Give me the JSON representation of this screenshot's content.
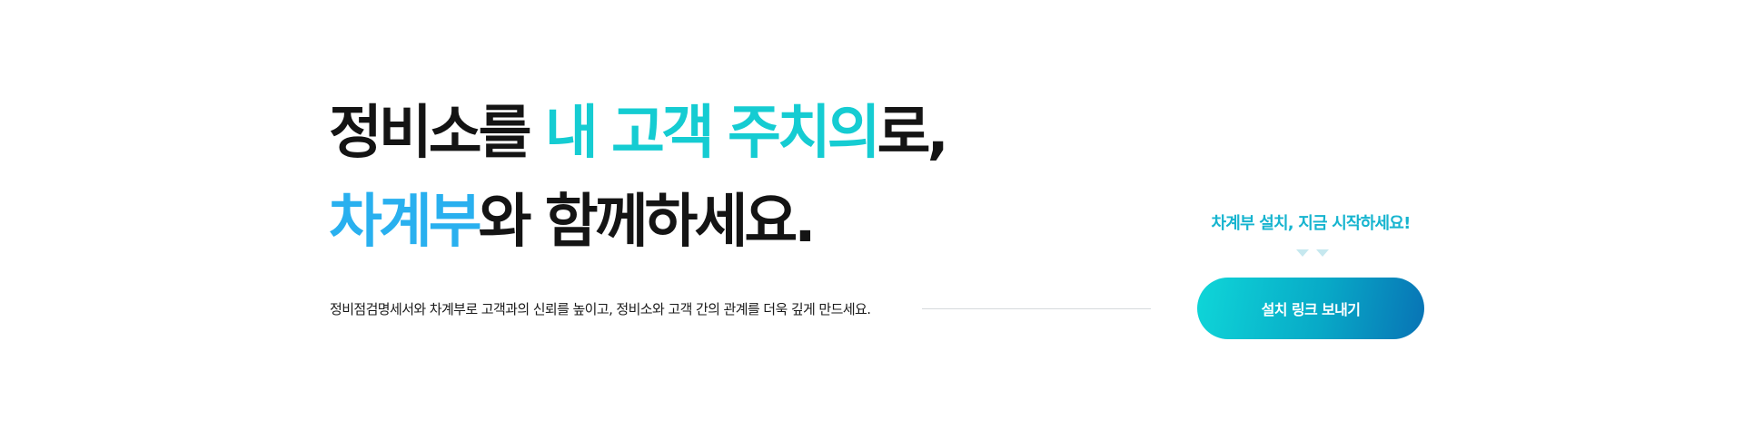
{
  "hero": {
    "line1": {
      "part1": "정비소를 ",
      "highlight": "내 고객 주치의",
      "part2": "로,"
    },
    "line2": {
      "highlight": "차계부",
      "part2": "와 함께하세요."
    },
    "description": "정비점검명세서와 차계부로 고객과의 신뢰를 높이고, 정비소와 고객 간의 관계를 더욱 깊게 만드세요."
  },
  "cta": {
    "caption": "차계부 설치, 지금 시작하세요!",
    "button_label": "설치 링크 보내기"
  },
  "colors": {
    "teal_accent": "#15ccd2",
    "blue_accent": "#29b0ef",
    "caption": "#16b4cf",
    "button_gradient_start": "#0fd6d8",
    "button_gradient_end": "#0873b5"
  },
  "icons": {
    "chevrons": "double-chevron-down-icon"
  }
}
